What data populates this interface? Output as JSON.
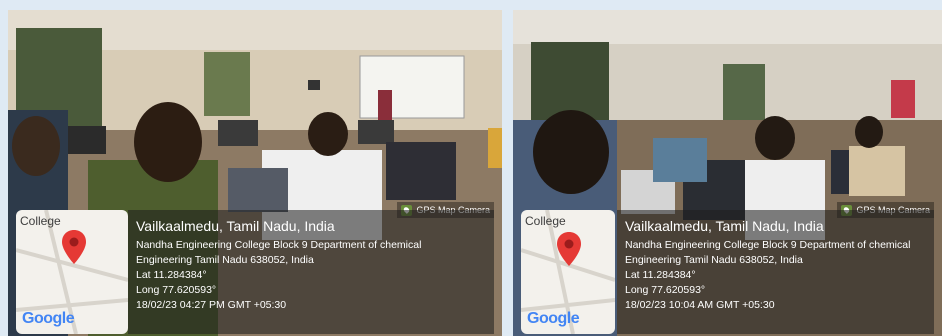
{
  "photos": [
    {
      "brand": "GPS Map Camera",
      "map_label": "College",
      "map_brand": "Google",
      "location": "Vailkaalmedu, Tamil Nadu, India",
      "address_1": "Nandha Engineering College Block 9 Department of chemical",
      "address_2": "Engineering Tamil Nadu 638052, India",
      "lat": "Lat 11.284384°",
      "long": "Long 77.620593°",
      "datetime": "18/02/23 04:27 PM GMT +05:30"
    },
    {
      "brand": "GPS Map Camera",
      "map_label": "College",
      "map_brand": "Google",
      "location": "Vailkaalmedu, Tamil Nadu, India",
      "address_1": "Nandha Engineering College Block 9 Department of chemical",
      "address_2": "Engineering Tamil Nadu 638052, India",
      "lat": "Lat 11.284384°",
      "long": "Long 77.620593°",
      "datetime": "18/02/23 10:04 AM GMT +05:30"
    }
  ]
}
